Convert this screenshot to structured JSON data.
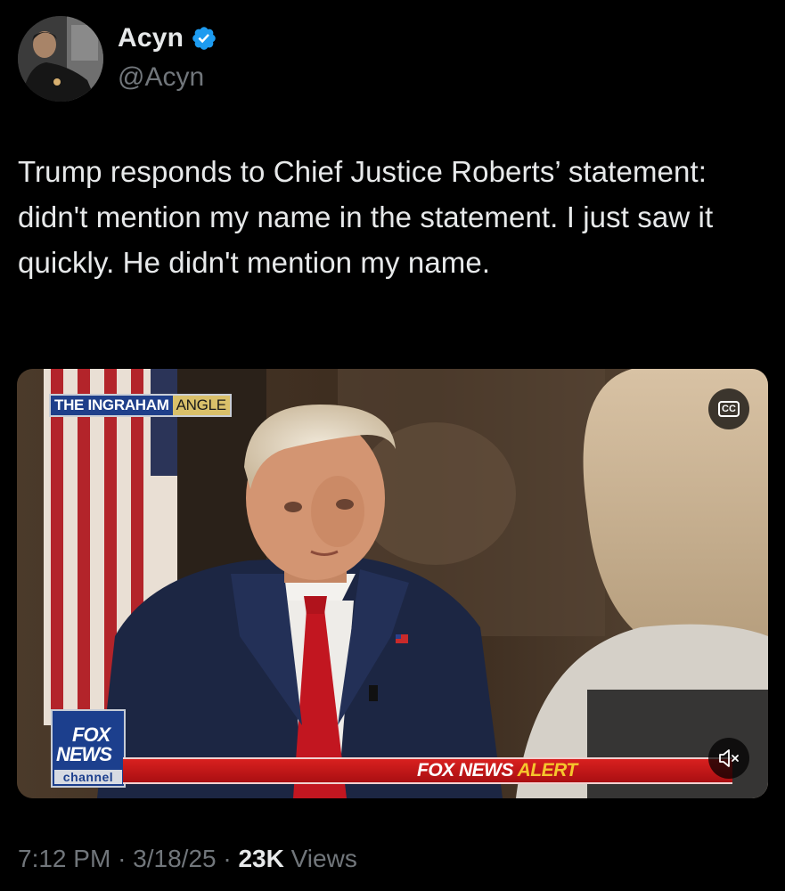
{
  "author": {
    "display_name": "Acyn",
    "handle": "@Acyn",
    "verified": true,
    "verified_color": "#1d9bf0"
  },
  "tweet": {
    "text": "Trump responds to Chief Justice Roberts’ statement: didn't mention my name in the statement. I just saw it quickly. He didn't mention my name."
  },
  "media": {
    "show_title_part1": "THE INGRAHAM",
    "show_title_part2": "ANGLE",
    "logo_line1": "FOX",
    "logo_line2": "NEWS",
    "logo_line3": "channel",
    "alert_part1": "FOX NEWS",
    "alert_part2": "ALERT",
    "cc_label": "CC",
    "cc_icon": "closed-captions-icon",
    "mute_icon": "speaker-muted-icon"
  },
  "meta": {
    "time": "7:12 PM",
    "sep1": "·",
    "date": "3/18/25",
    "sep2": "·",
    "views_count": "23K",
    "views_label": "Views"
  },
  "colors": {
    "background": "#000000",
    "text": "#e7e9ea",
    "secondary": "#71767b",
    "alert_red": "#d9201f",
    "alert_yellow": "#f5c62d"
  }
}
